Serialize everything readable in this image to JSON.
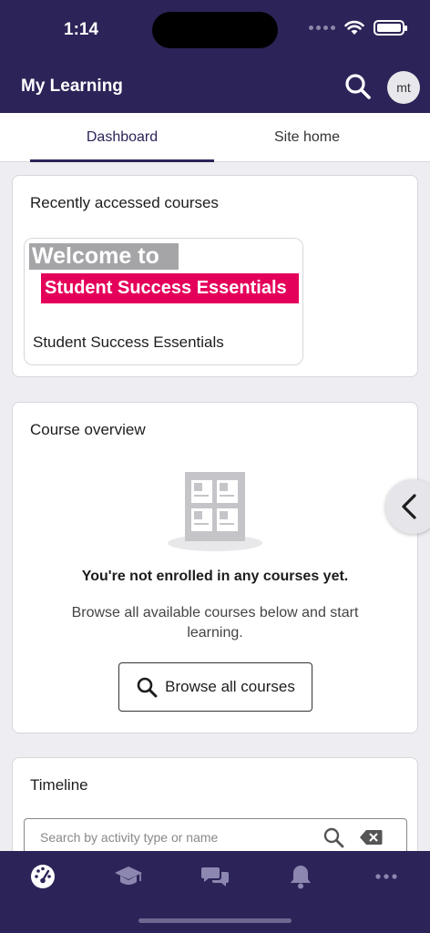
{
  "status_bar": {
    "time": "1:14"
  },
  "header": {
    "title": "My Learning",
    "avatar_initials": "mt"
  },
  "tabs": [
    {
      "label": "Dashboard",
      "active": true
    },
    {
      "label": "Site home",
      "active": false
    }
  ],
  "recent_courses": {
    "title": "Recently accessed courses",
    "courses": [
      {
        "name": "Student Success Essentials",
        "image_line1": "Welcome to",
        "image_line2": "Student Success Essentials"
      }
    ]
  },
  "course_overview": {
    "title": "Course overview",
    "empty_title": "You're not enrolled in any courses yet.",
    "empty_text": "Browse all available courses below and start learning.",
    "browse_label": "Browse all courses"
  },
  "timeline": {
    "title": "Timeline",
    "search_placeholder": "Search by activity type or name"
  },
  "bottom_nav": {
    "items": [
      "dashboard-icon",
      "courses-icon",
      "messages-icon",
      "notifications-icon",
      "more-icon"
    ]
  },
  "colors": {
    "primary": "#2c2458",
    "brand_pink": "#e4005a",
    "background": "#eeeef2"
  }
}
